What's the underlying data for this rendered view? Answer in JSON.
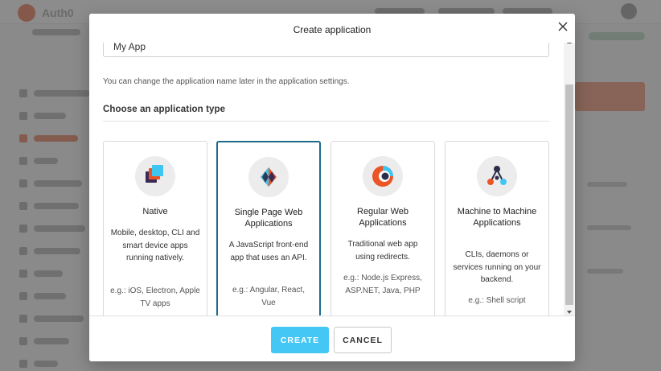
{
  "background": {
    "logo_text": "Auth0"
  },
  "modal": {
    "title": "Create application",
    "name_input": {
      "value": "My App"
    },
    "name_help": "You can change the application name later in the application settings.",
    "section_title": "Choose an application type",
    "cards": [
      {
        "icon": "native-app-icon",
        "title": "Native",
        "description": "Mobile, desktop, CLI and smart device apps running natively.",
        "example": "e.g.: iOS, Electron, Apple TV apps",
        "selected": false
      },
      {
        "icon": "spa-icon",
        "title": "Single Page Web Applications",
        "description": "A JavaScript front-end app that uses an API.",
        "example": "e.g.: Angular, React, Vue",
        "selected": true
      },
      {
        "icon": "regular-web-app-icon",
        "title": "Regular Web Applications",
        "description": "Traditional web app using redirects.",
        "example": "e.g.: Node.js Express, ASP.NET, Java, PHP",
        "selected": false
      },
      {
        "icon": "m2m-icon",
        "title": "Machine to Machine Applications",
        "description": "CLIs, daemons or services running on your backend.",
        "example": "e.g.: Shell script",
        "selected": false
      }
    ],
    "buttons": {
      "create": "CREATE",
      "cancel": "CANCEL"
    }
  },
  "colors": {
    "primary_button": "#44c7f4",
    "selected_border": "#1e6a8d",
    "brand": "#eb5424"
  }
}
